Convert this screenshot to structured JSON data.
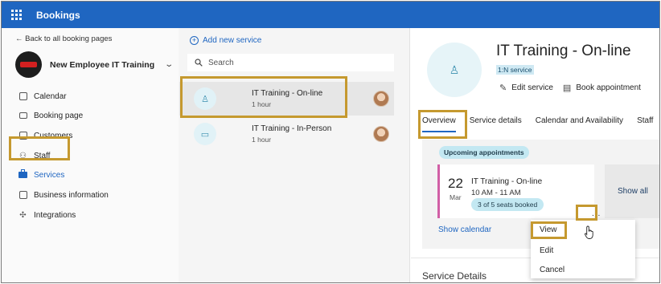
{
  "app": {
    "title": "Bookings"
  },
  "sidebar": {
    "back_label": "Back to all booking pages",
    "page_name": "New Employee IT Training",
    "items": [
      {
        "label": "Calendar",
        "icon": "calendar-icon"
      },
      {
        "label": "Booking page",
        "icon": "monitor-icon"
      },
      {
        "label": "Customers",
        "icon": "contact-card-icon"
      },
      {
        "label": "Staff",
        "icon": "people-icon"
      },
      {
        "label": "Services",
        "icon": "briefcase-icon",
        "active": true
      },
      {
        "label": "Business information",
        "icon": "building-icon"
      },
      {
        "label": "Integrations",
        "icon": "integrations-icon"
      }
    ]
  },
  "services_list": {
    "add_label": "Add new service",
    "search_placeholder": "Search",
    "items": [
      {
        "name": "IT Training - On-line",
        "duration": "1 hour",
        "selected": true
      },
      {
        "name": "IT Training - In-Person",
        "duration": "1 hour",
        "selected": false
      }
    ]
  },
  "detail": {
    "title": "IT Training - On-line",
    "service_type": "1:N service",
    "edit_label": "Edit service",
    "book_label": "Book appointment",
    "tabs": [
      "Overview",
      "Service details",
      "Calendar and Availability",
      "Staff"
    ],
    "active_tab": "Overview",
    "upcoming_label": "Upcoming appointments",
    "appointment": {
      "day": "22",
      "month": "Mar",
      "title": "IT Training - On-line",
      "time": "10 AM - 11 AM",
      "seats": "3 of 5 seats booked"
    },
    "more_label": "...",
    "show_all_label": "Show all",
    "show_calendar_label": "Show calendar",
    "section_heading": "Service Details"
  },
  "context_menu": {
    "items": [
      "View",
      "Edit",
      "Cancel"
    ]
  },
  "colors": {
    "accent": "#1f66c1",
    "highlight": "#c5992f",
    "appointment_bar": "#d15fa6",
    "badge_bg": "#c3e8f2"
  }
}
